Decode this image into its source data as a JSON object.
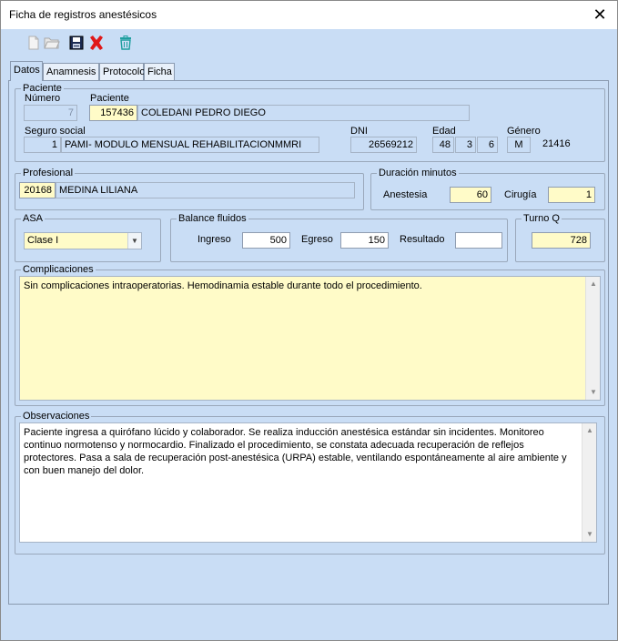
{
  "window": {
    "title": "Ficha de registros anestésicos",
    "close_glyph": "✕"
  },
  "toolbar": {
    "buttons": [
      {
        "name": "new-icon",
        "enabled": false
      },
      {
        "name": "open-folder-icon",
        "enabled": false
      },
      {
        "name": "save-icon",
        "enabled": true
      },
      {
        "name": "delete-icon",
        "enabled": true
      },
      {
        "name": "trash-icon",
        "enabled": true
      }
    ]
  },
  "tabs": [
    {
      "label": "Datos",
      "active": true
    },
    {
      "label": "Anamnesis",
      "active": false
    },
    {
      "label": "Protocolo",
      "active": false
    },
    {
      "label": "Ficha",
      "active": false
    }
  ],
  "paciente": {
    "group_label": "Paciente",
    "numero_label": "Número",
    "numero_value": "7",
    "paciente_label": "Paciente",
    "paciente_id": "157436",
    "paciente_nombre": "COLEDANI PEDRO DIEGO",
    "seguro_label": "Seguro social",
    "seguro_id": "1",
    "seguro_nombre": "PAMI- MODULO MENSUAL REHABILITACIONMMRI",
    "dni_label": "DNI",
    "dni_value": "26569212",
    "edad_label": "Edad",
    "edad_anios": "48",
    "edad_meses": "3",
    "edad_dias": "6",
    "genero_label": "Género",
    "genero_value": "M",
    "genero_code": "21416"
  },
  "profesional": {
    "group_label": "Profesional",
    "id": "20168",
    "nombre": "MEDINA LILIANA"
  },
  "duracion": {
    "group_label": "Duración minutos",
    "anestesia_label": "Anestesia",
    "anestesia_value": "60",
    "cirugia_label": "Cirugía",
    "cirugia_value": "1"
  },
  "asa": {
    "group_label": "ASA",
    "selected": "Clase I"
  },
  "balance": {
    "group_label": "Balance fluidos",
    "ingreso_label": "Ingreso",
    "ingreso_value": "500",
    "egreso_label": "Egreso",
    "egreso_value": "150",
    "resultado_label": "Resultado",
    "resultado_value": ""
  },
  "turno": {
    "group_label": "Turno Q",
    "value": "728"
  },
  "complicaciones": {
    "group_label": "Complicaciones",
    "text": "Sin complicaciones intraoperatorias. Hemodinamia estable durante todo el procedimiento."
  },
  "observaciones": {
    "group_label": "Observaciones",
    "text": "Paciente ingresa a quirófano lúcido y colaborador. Se realiza inducción anestésica estándar sin incidentes. Monitoreo continuo normotenso y normocardio. Finalizado el procedimiento, se constata adecuada recuperación de reflejos protectores. Pasa a sala de recuperación post-anestésica (URPA) estable, ventilando espontáneamente al aire ambiente y con buen manejo del dolor."
  },
  "scroll_glyphs": {
    "up": "▲",
    "down": "▼"
  },
  "combo_glyph": "▼"
}
